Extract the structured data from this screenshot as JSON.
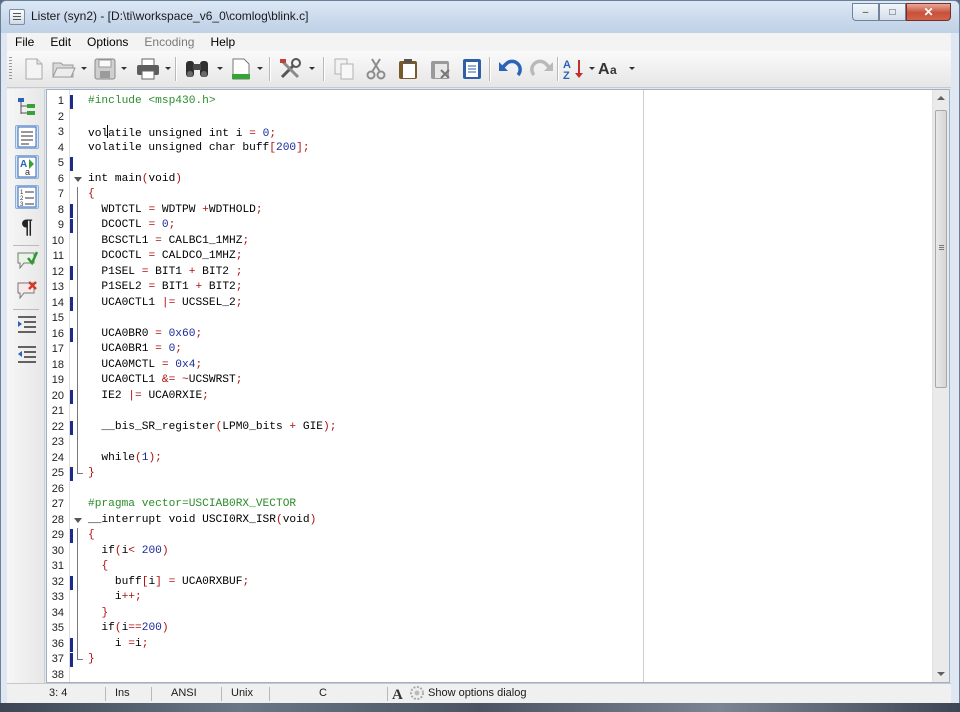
{
  "window": {
    "title": "Lister (syn2) - [D:\\ti\\workspace_v6_0\\comlog\\blink.c]",
    "controls": {
      "minimize": "–",
      "maximize": "□",
      "close": "✕"
    }
  },
  "menu": {
    "items": [
      {
        "label": "File",
        "enabled": true
      },
      {
        "label": "Edit",
        "enabled": true
      },
      {
        "label": "Options",
        "enabled": true
      },
      {
        "label": "Encoding",
        "enabled": false
      },
      {
        "label": "Help",
        "enabled": true
      }
    ]
  },
  "toolbar": {
    "icons": [
      "new-file-icon",
      "open-folder-icon",
      "save-icon",
      "print-icon",
      "find-binoculars-icon",
      "export-page-icon",
      "tools-icon",
      "copy-icon",
      "cut-icon",
      "paste-icon",
      "delete-icon",
      "clipboard-list-icon",
      "undo-icon",
      "redo-icon",
      "sort-az-icon",
      "font-aa-icon"
    ]
  },
  "sidetoolbar": {
    "icons": [
      "tree-icon",
      "text-view-icon",
      "font-text-icon",
      "numbered-list-icon",
      "pilcrow-icon",
      "comment-add-icon",
      "comment-remove-icon",
      "indent-increase-icon",
      "indent-decrease-icon"
    ],
    "pilcrow": "¶"
  },
  "editor": {
    "lines": [
      {
        "n": "1",
        "mark": true,
        "fold": "",
        "html": "<span class=\"pp\">#include &lt;msp430.h&gt;</span>"
      },
      {
        "n": "2",
        "mark": false,
        "fold": "",
        "html": ""
      },
      {
        "n": "3",
        "mark": false,
        "fold": "",
        "html": "vol<span class=\"caret\"></span>atile unsigned int i <span class=\"op\">=</span> <span class=\"num\">0</span><span class=\"op\">;</span>"
      },
      {
        "n": "4",
        "mark": false,
        "fold": "",
        "html": "volatile unsigned char buff<span class=\"op\">[</span><span class=\"num\">200</span><span class=\"op\">];</span>"
      },
      {
        "n": "5",
        "mark": true,
        "fold": "",
        "html": ""
      },
      {
        "n": "6",
        "mark": false,
        "fold": "open",
        "html": "int main<span class=\"op\">(</span>void<span class=\"op\">)</span>"
      },
      {
        "n": "7",
        "mark": false,
        "fold": "line",
        "html": "<span class=\"op\">{</span>"
      },
      {
        "n": "8",
        "mark": true,
        "fold": "line",
        "html": "  WDTCTL <span class=\"op\">=</span> WDTPW <span class=\"op\">+</span>WDTHOLD<span class=\"op\">;</span>"
      },
      {
        "n": "9",
        "mark": true,
        "fold": "line",
        "html": "  DCOCTL <span class=\"op\">=</span> <span class=\"num\">0</span><span class=\"op\">;</span>"
      },
      {
        "n": "10",
        "mark": false,
        "fold": "line",
        "html": "  BCSCTL1 <span class=\"op\">=</span> CALBC1_1MHZ<span class=\"op\">;</span>"
      },
      {
        "n": "11",
        "mark": false,
        "fold": "line",
        "html": "  DCOCTL <span class=\"op\">=</span> CALDCO_1MHZ<span class=\"op\">;</span>"
      },
      {
        "n": "12",
        "mark": true,
        "fold": "line",
        "html": "  P1SEL <span class=\"op\">=</span> BIT1 <span class=\"op\">+</span> BIT2 <span class=\"op\">;</span>"
      },
      {
        "n": "13",
        "mark": false,
        "fold": "line",
        "html": "  P1SEL2 <span class=\"op\">=</span> BIT1 <span class=\"op\">+</span> BIT2<span class=\"op\">;</span>"
      },
      {
        "n": "14",
        "mark": true,
        "fold": "line",
        "html": "  UCA0CTL1 <span class=\"op\">|=</span> UCSSEL_2<span class=\"op\">;</span>"
      },
      {
        "n": "15",
        "mark": false,
        "fold": "line",
        "html": ""
      },
      {
        "n": "16",
        "mark": true,
        "fold": "line",
        "html": "  UCA0BR0 <span class=\"op\">=</span> <span class=\"num\">0x60</span><span class=\"op\">;</span>"
      },
      {
        "n": "17",
        "mark": false,
        "fold": "line",
        "html": "  UCA0BR1 <span class=\"op\">=</span> <span class=\"num\">0</span><span class=\"op\">;</span>"
      },
      {
        "n": "18",
        "mark": false,
        "fold": "line",
        "html": "  UCA0MCTL <span class=\"op\">=</span> <span class=\"num\">0x4</span><span class=\"op\">;</span>"
      },
      {
        "n": "19",
        "mark": false,
        "fold": "line",
        "html": "  UCA0CTL1 <span class=\"op\">&amp;=</span> <span class=\"op\">~</span>UCSWRST<span class=\"op\">;</span>"
      },
      {
        "n": "20",
        "mark": true,
        "fold": "line",
        "html": "  IE2 <span class=\"op\">|=</span> UCA0RXIE<span class=\"op\">;</span>"
      },
      {
        "n": "21",
        "mark": false,
        "fold": "line",
        "html": ""
      },
      {
        "n": "22",
        "mark": true,
        "fold": "line",
        "html": "  __bis_SR_register<span class=\"op\">(</span>LPM0_bits <span class=\"op\">+</span> GIE<span class=\"op\">);</span>"
      },
      {
        "n": "23",
        "mark": false,
        "fold": "line",
        "html": ""
      },
      {
        "n": "24",
        "mark": false,
        "fold": "line",
        "html": "  while<span class=\"op\">(</span><span class=\"num\">1</span><span class=\"op\">);</span>"
      },
      {
        "n": "25",
        "mark": true,
        "fold": "end",
        "html": "<span class=\"op\">}</span>"
      },
      {
        "n": "26",
        "mark": false,
        "fold": "",
        "html": ""
      },
      {
        "n": "27",
        "mark": false,
        "fold": "",
        "html": "<span class=\"pp\">#pragma vector=USCIAB0RX_VECTOR</span>"
      },
      {
        "n": "28",
        "mark": false,
        "fold": "open",
        "html": "__interrupt void USCI0RX_ISR<span class=\"op\">(</span>void<span class=\"op\">)</span>"
      },
      {
        "n": "29",
        "mark": true,
        "fold": "line",
        "html": "<span class=\"op\">{</span>"
      },
      {
        "n": "30",
        "mark": false,
        "fold": "line",
        "html": "  if<span class=\"op\">(</span>i<span class=\"op\">&lt;</span> <span class=\"num\">200</span><span class=\"op\">)</span>"
      },
      {
        "n": "31",
        "mark": false,
        "fold": "line",
        "html": "  <span class=\"op\">{</span>"
      },
      {
        "n": "32",
        "mark": true,
        "fold": "line",
        "html": "    buff<span class=\"op\">[</span>i<span class=\"op\">]</span> <span class=\"op\">=</span> UCA0RXBUF<span class=\"op\">;</span>"
      },
      {
        "n": "33",
        "mark": false,
        "fold": "line",
        "html": "    i<span class=\"op\">++;</span>"
      },
      {
        "n": "34",
        "mark": false,
        "fold": "line",
        "html": "  <span class=\"op\">}</span>"
      },
      {
        "n": "35",
        "mark": false,
        "fold": "line",
        "html": "  if<span class=\"op\">(</span>i<span class=\"op\">==</span><span class=\"num\">200</span><span class=\"op\">)</span>"
      },
      {
        "n": "36",
        "mark": true,
        "fold": "line",
        "html": "    i <span class=\"op\">=</span>i<span class=\"op\">;</span>"
      },
      {
        "n": "37",
        "mark": true,
        "fold": "end",
        "html": "<span class=\"op\">}</span>"
      },
      {
        "n": "38",
        "mark": false,
        "fold": "",
        "html": ""
      }
    ]
  },
  "status": {
    "position": "3: 4",
    "mode": "Ins",
    "encoding": "ANSI",
    "line_endings": "Unix",
    "syntax": "C",
    "options_label": "Show options dialog"
  }
}
